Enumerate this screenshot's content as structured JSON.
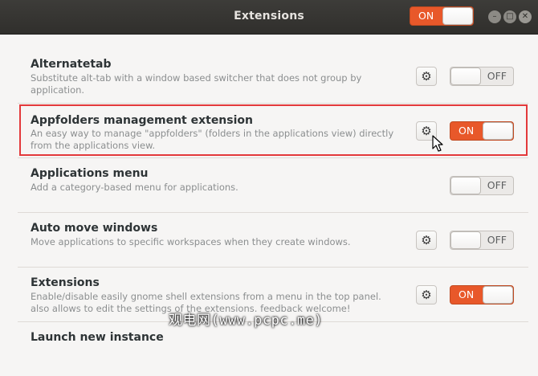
{
  "window": {
    "title": "Extensions",
    "master_toggle": "ON",
    "controls": [
      "minimize",
      "maximize",
      "close"
    ]
  },
  "colors": {
    "on": "#e8582a",
    "highlight": "#e3393b",
    "titlebar": "#302f2c"
  },
  "extensions": [
    {
      "name": "Alternatetab",
      "desc": "Substitute alt-tab with a window based switcher that does not group by application.",
      "has_settings": true,
      "state": "OFF"
    },
    {
      "name": "Appfolders management extension",
      "desc": "An easy way to manage \"appfolders\" (folders in the applications view) directly from the applications view.",
      "has_settings": true,
      "state": "ON",
      "highlighted": true
    },
    {
      "name": "Applications menu",
      "desc": "Add a category-based menu for applications.",
      "has_settings": false,
      "state": "OFF"
    },
    {
      "name": "Auto move windows",
      "desc": "Move applications to specific workspaces when they create windows.",
      "has_settings": true,
      "state": "OFF"
    },
    {
      "name": "Extensions",
      "desc": "Enable/disable easily gnome shell extensions from a menu in the top panel. also allows to edit the settings of the extensions. feedback welcome!",
      "has_settings": true,
      "state": "ON"
    },
    {
      "name": "Launch new instance",
      "desc": "",
      "has_settings": false,
      "state": ""
    }
  ],
  "watermark": "观电网(www.pcpc.me)"
}
